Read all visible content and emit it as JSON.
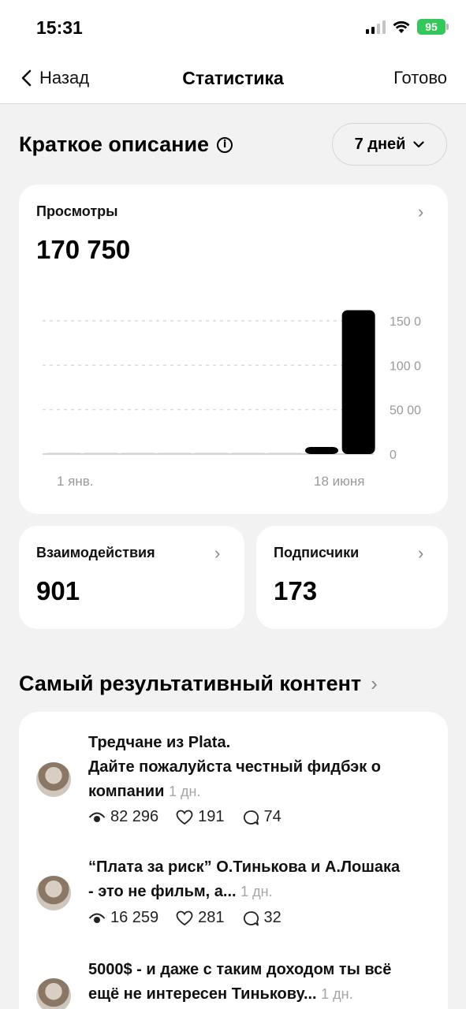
{
  "status_bar": {
    "time": "15:31",
    "battery": "95"
  },
  "nav": {
    "back_label": "Назад",
    "title": "Статистика",
    "done_label": "Готово"
  },
  "summary": {
    "title": "Краткое описание",
    "period": "7 дней"
  },
  "views": {
    "label": "Просмотры",
    "value": "170 750",
    "chart_data": {
      "type": "bar",
      "categories": [
        "1 янв.",
        "",
        "",
        "",
        "",
        "",
        "",
        "18 июня",
        ""
      ],
      "values": [
        0,
        0,
        0,
        0,
        0,
        0,
        0,
        8000,
        162000
      ],
      "ylim": [
        0,
        150000
      ],
      "yticks": [
        "0",
        "50 00",
        "100 0",
        "150 0"
      ],
      "ytick_values": [
        0,
        50000,
        100000,
        150000
      ],
      "xtick_labels": [
        "1 янв.",
        "18 июня"
      ],
      "grid": true,
      "bar_color": "#000000"
    }
  },
  "interactions": {
    "label": "Взаимодействия",
    "value": "901"
  },
  "followers": {
    "label": "Подписчики",
    "value": "173"
  },
  "top_content": {
    "title": "Самый результативный контент",
    "posts": [
      {
        "lines": [
          "Тредчане из Plata.",
          "Дайте пожалуйста честный фидбэк о",
          "компании"
        ],
        "time": "1 дн.",
        "views": "82 296",
        "likes": "191",
        "comments": "74"
      },
      {
        "lines": [
          "“Плата за риск” О.Тинькова и А.Лошака",
          "- это не фильм, а..."
        ],
        "time": "1 дн.",
        "views": "16 259",
        "likes": "281",
        "comments": "32"
      },
      {
        "lines": [
          "5000$ - и даже с таким доходом ты всё",
          "ещё не интересен Тинькову..."
        ],
        "time": "1 дн."
      }
    ]
  }
}
